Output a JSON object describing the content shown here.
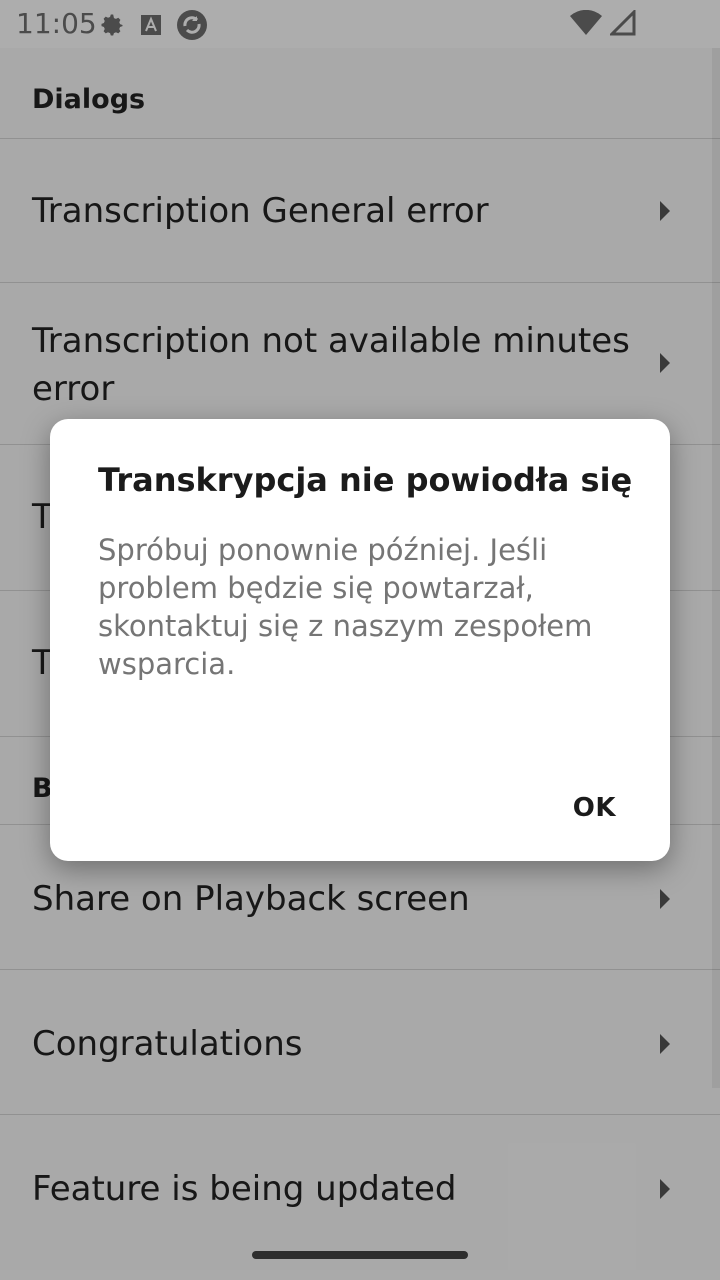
{
  "status_bar": {
    "time": "11:05",
    "icons_left": [
      "gear-icon",
      "font-a-icon",
      "sync-icon"
    ],
    "icons_right": [
      "wifi-icon",
      "signal-icon"
    ]
  },
  "list": {
    "section_dialogs": "Dialogs",
    "items": [
      {
        "label": "Transcription General error"
      },
      {
        "label": "Transcription not available minutes error"
      },
      {
        "label": "T"
      },
      {
        "label": "T"
      }
    ],
    "section_b_partial": "B",
    "items_after": [
      {
        "label": "Share on Playback screen"
      },
      {
        "label": "Congratulations"
      },
      {
        "label": "Feature is being updated"
      }
    ]
  },
  "dialog": {
    "title": "Transkrypcja nie powiodła się",
    "message": "Spróbuj ponownie później. Jeśli problem będzie się powtarzał, skontaktuj się z naszym zespołem wsparcia.",
    "ok_label": "OK"
  },
  "colors": {
    "scrim": "#000000",
    "dialog_bg": "#ffffff",
    "text_primary": "#1b1b1b",
    "text_secondary": "#757575"
  }
}
